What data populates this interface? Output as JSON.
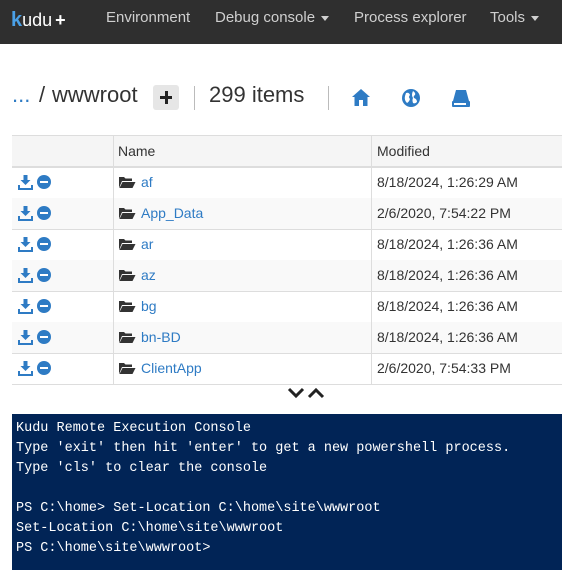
{
  "navbar": {
    "brand_letter": "k",
    "brand_rest": "udu",
    "brand_plus": "+",
    "items": [
      {
        "label": "Environment"
      },
      {
        "label": "Debug console",
        "dropdown": true
      },
      {
        "label": "Process explorer"
      },
      {
        "label": "Tools",
        "dropdown": true
      }
    ],
    "colors": {
      "background": "#2f2f2f",
      "text": "#cfcfcf",
      "brand_accent": "#4aa0e6"
    }
  },
  "breadcrumb": {
    "ellipsis": "...",
    "separator": "/",
    "current": "wwwroot",
    "add_label": "+"
  },
  "item_count": "299 items",
  "toolbar_icons": [
    "home-icon",
    "globe-icon",
    "drive-icon"
  ],
  "table": {
    "columns": [
      "Name",
      "Modified"
    ],
    "rows": [
      {
        "name": "af",
        "modified": "8/18/2024, 1:26:29 AM"
      },
      {
        "name": "App_Data",
        "modified": "2/6/2020, 7:54:22 PM"
      },
      {
        "name": "ar",
        "modified": "8/18/2024, 1:26:36 AM"
      },
      {
        "name": "az",
        "modified": "8/18/2024, 1:26:36 AM"
      },
      {
        "name": "bg",
        "modified": "8/18/2024, 1:26:36 AM"
      },
      {
        "name": "bn-BD",
        "modified": "8/18/2024, 1:26:36 AM"
      },
      {
        "name": "ClientApp",
        "modified": "2/6/2020, 7:54:33 PM"
      }
    ]
  },
  "console": {
    "lines": [
      "Kudu Remote Execution Console",
      "Type 'exit' then hit 'enter' to get a new powershell process.",
      "Type 'cls' to clear the console",
      "",
      "PS C:\\home> Set-Location C:\\home\\site\\wwwroot",
      "Set-Location C:\\home\\site\\wwwroot",
      "PS C:\\home\\site\\wwwroot>"
    ],
    "background": "#012456"
  },
  "link_color": "#2e7bc4"
}
